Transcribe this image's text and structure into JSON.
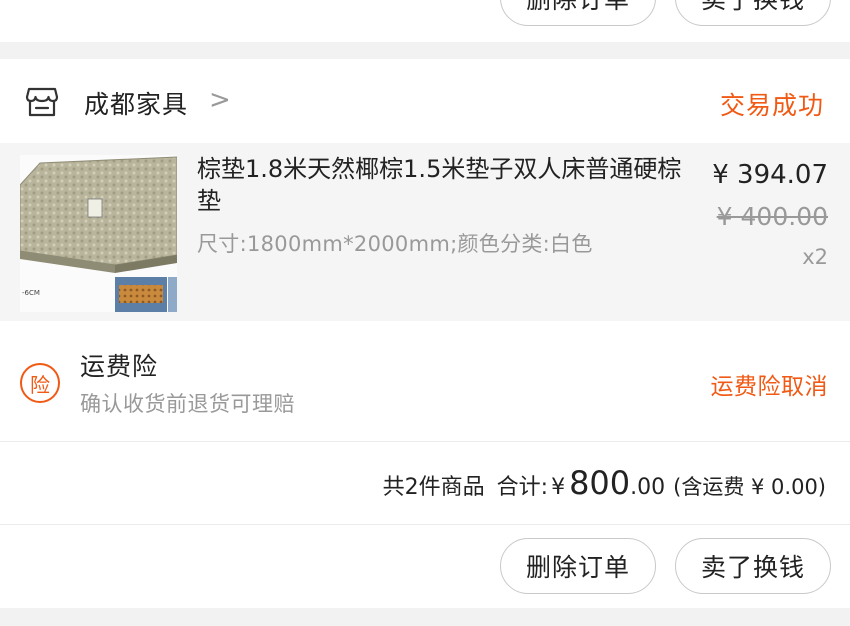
{
  "previous_order": {
    "delete_label": "删除订单",
    "sell_label": "卖了换钱"
  },
  "order": {
    "store": {
      "name": "成都家具",
      "chevron": ">",
      "status": "交易成功",
      "icon": "store-icon"
    },
    "item": {
      "title": "棕垫1.8米天然椰棕1.5米垫子双人床普通硬棕垫",
      "spec": "尺寸:1800mm*2000mm;颜色分类:白色",
      "price": "¥ 394.07",
      "original_price": "¥ 400.00",
      "quantity": "x2",
      "image_text": "-6CM"
    },
    "insurance": {
      "badge": "险",
      "title": "运费险",
      "description": "确认收货前退货可理赔",
      "cancel_label": "运费险取消"
    },
    "summary": {
      "count_text": "共2件商品",
      "total_label": "合计:",
      "currency": "¥",
      "total_integer": "800",
      "total_decimal": ".00",
      "shipping_text": "(含运费 ¥ 0.00)"
    },
    "actions": {
      "delete_label": "删除订单",
      "sell_label": "卖了换钱"
    }
  },
  "colors": {
    "accent": "#f05a14",
    "secondary_text": "#999999",
    "page_background": "#f2f2f2"
  }
}
